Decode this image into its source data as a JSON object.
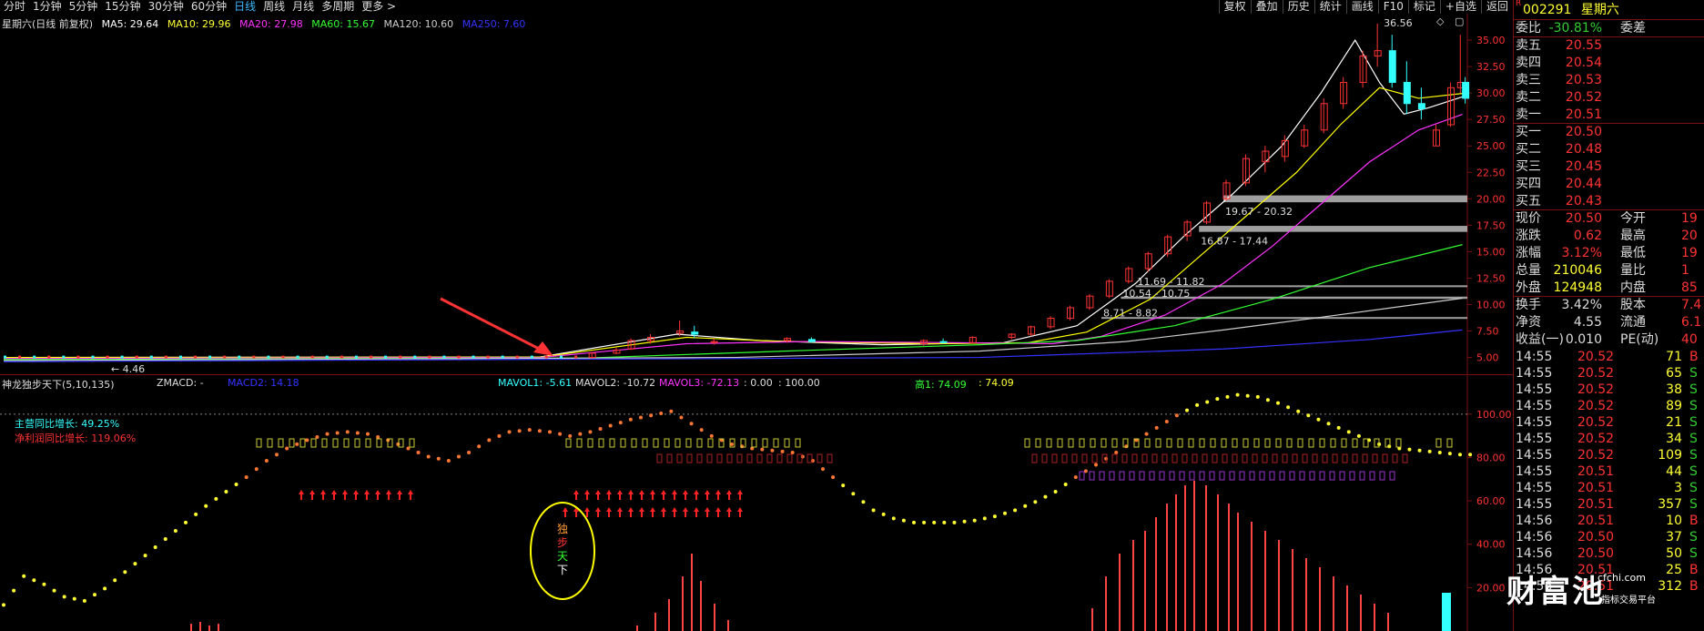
{
  "timeframes": [
    "分时",
    "1分钟",
    "5分钟",
    "15分钟",
    "30分钟",
    "60分钟",
    "日线",
    "周线",
    "月线",
    "多周期",
    "更多 >"
  ],
  "active_tab": "日线",
  "toolbar": [
    "复权",
    "叠加",
    "历史",
    "统计",
    "画线",
    "F10",
    "标记",
    "+自选",
    "返回"
  ],
  "main_legend": {
    "title": "星期六(日线 前复权)",
    "ma5": "MA5: 29.64",
    "ma10": "MA10: 29.96",
    "ma20": "MA20: 27.98",
    "ma60": "MA60: 15.67",
    "ma120": "MA120: 10.60",
    "ma250": "MA250: 7.60"
  },
  "colors": {
    "ma5": "#ffffff",
    "ma10": "#ffff00",
    "ma20": "#ff33ff",
    "ma60": "#33ff33",
    "ma120": "#cccccc",
    "ma250": "#3333ff",
    "up": "#ff3333",
    "down": "#33ffff",
    "accent": "#3db8ff"
  },
  "price_labels": {
    "high": "36.56",
    "low": "4.46",
    "box1": "19.67 - 20.32",
    "box2": "16.87 - 17.44",
    "box3": "11.69 - 11.82",
    "box4": "10.54 - 10.75",
    "box5": "8.71 - 8.82"
  },
  "sub_legend": {
    "title": "神龙独步天下(5,10,135)",
    "zmacd": "ZMACD: -",
    "macd2": "MACD2: 14.18",
    "mavol1": "MAVOL1: -5.61",
    "mavol2": "MAVOL2: -10.72",
    "mavol3": "MAVOL3: -72.13",
    "v1": ": 0.00",
    "v2": ": 100.00",
    "gao": "高1: 74.09",
    "v3": ": 74.09"
  },
  "indicator_labels": {
    "revenue": "主营同比增长: 49.25%",
    "profit": "净利润同比增长: 119.06%"
  },
  "circle_text": [
    "独",
    "步",
    "天",
    "下"
  ],
  "chart_data": [
    {
      "type": "line",
      "title": "星期六(日线 前复权)",
      "ylim": [
        3.5,
        37.5
      ],
      "yticks": [
        5.0,
        7.5,
        10.0,
        12.5,
        15.0,
        17.5,
        20.0,
        22.5,
        25.0,
        27.5,
        30.0,
        32.5,
        35.0
      ],
      "ytick_labels": [
        "5.00",
        "7.50",
        "10.00",
        "12.50",
        "15.00",
        "17.50",
        "20.00",
        "22.50",
        "25.00",
        "27.50",
        "30.00",
        "32.50",
        "35.00"
      ],
      "x_count": 300,
      "series": [
        {
          "name": "MA5",
          "key": "ma5",
          "points": [
            [
              0,
              5.0
            ],
            [
              110,
              5.05
            ],
            [
              138,
              7.2
            ],
            [
              155,
              6.6
            ],
            [
              180,
              6.2
            ],
            [
              205,
              6.4
            ],
            [
              220,
              8.0
            ],
            [
              232,
              12.0
            ],
            [
              242,
              16.5
            ],
            [
              252,
              20.5
            ],
            [
              262,
              25.0
            ],
            [
              270,
              30.0
            ],
            [
              277,
              35.0
            ],
            [
              282,
              31.0
            ],
            [
              287,
              28.0
            ],
            [
              292,
              28.6
            ],
            [
              299,
              29.64
            ]
          ]
        },
        {
          "name": "MA10",
          "key": "ma10",
          "points": [
            [
              0,
              5.0
            ],
            [
              110,
              5.03
            ],
            [
              140,
              6.9
            ],
            [
              160,
              6.5
            ],
            [
              190,
              6.3
            ],
            [
              210,
              6.4
            ],
            [
              222,
              7.4
            ],
            [
              235,
              10.5
            ],
            [
              245,
              14.5
            ],
            [
              255,
              18.5
            ],
            [
              265,
              22.5
            ],
            [
              274,
              27.0
            ],
            [
              282,
              30.5
            ],
            [
              290,
              29.5
            ],
            [
              299,
              29.96
            ]
          ]
        },
        {
          "name": "MA20",
          "key": "ma20",
          "points": [
            [
              0,
              4.9
            ],
            [
              110,
              5.0
            ],
            [
              140,
              6.3
            ],
            [
              165,
              6.5
            ],
            [
              195,
              6.4
            ],
            [
              215,
              6.3
            ],
            [
              225,
              7.0
            ],
            [
              238,
              9.0
            ],
            [
              250,
              12.0
            ],
            [
              260,
              15.5
            ],
            [
              270,
              19.5
            ],
            [
              280,
              23.5
            ],
            [
              290,
              26.5
            ],
            [
              299,
              27.98
            ]
          ]
        },
        {
          "name": "MA60",
          "key": "ma60",
          "points": [
            [
              0,
              4.8
            ],
            [
              120,
              4.95
            ],
            [
              160,
              5.6
            ],
            [
              200,
              6.2
            ],
            [
              220,
              6.6
            ],
            [
              240,
              8.0
            ],
            [
              260,
              10.5
            ],
            [
              280,
              13.5
            ],
            [
              299,
              15.67
            ]
          ]
        },
        {
          "name": "MA120",
          "key": "ma120",
          "points": [
            [
              0,
              4.7
            ],
            [
              150,
              5.0
            ],
            [
              200,
              5.6
            ],
            [
              230,
              6.5
            ],
            [
              250,
              7.6
            ],
            [
              270,
              8.8
            ],
            [
              299,
              10.6
            ]
          ]
        },
        {
          "name": "MA250",
          "key": "ma250",
          "points": [
            [
              0,
              4.6
            ],
            [
              200,
              5.0
            ],
            [
              250,
              5.8
            ],
            [
              280,
              6.7
            ],
            [
              299,
              7.6
            ]
          ]
        }
      ],
      "candles": [
        [
          120,
          5.0,
          5.5,
          4.9,
          5.4
        ],
        [
          125,
          5.4,
          5.9,
          5.3,
          5.7
        ],
        [
          128,
          5.8,
          6.8,
          5.7,
          6.6
        ],
        [
          132,
          6.6,
          7.2,
          6.3,
          6.9
        ],
        [
          138,
          7.3,
          8.5,
          7.0,
          7.5
        ],
        [
          141,
          7.4,
          8.0,
          6.8,
          7.2
        ],
        [
          145,
          6.4,
          6.8,
          6.2,
          6.5
        ],
        [
          160,
          6.6,
          6.9,
          6.4,
          6.8
        ],
        [
          165,
          6.7,
          6.9,
          6.4,
          6.5
        ],
        [
          188,
          6.3,
          6.7,
          6.1,
          6.6
        ],
        [
          192,
          6.5,
          6.8,
          6.3,
          6.4
        ],
        [
          198,
          6.4,
          7.0,
          6.3,
          6.9
        ],
        [
          206,
          6.9,
          7.3,
          6.7,
          7.2
        ],
        [
          210,
          7.2,
          8.0,
          7.0,
          7.9
        ],
        [
          214,
          7.9,
          8.9,
          7.7,
          8.7
        ],
        [
          218,
          8.7,
          9.9,
          8.5,
          9.7
        ],
        [
          222,
          9.7,
          11.0,
          9.5,
          10.8
        ],
        [
          226,
          10.8,
          12.4,
          10.6,
          12.2
        ],
        [
          230,
          12.2,
          13.6,
          12.0,
          13.4
        ],
        [
          234,
          13.4,
          15.0,
          13.1,
          14.8
        ],
        [
          238,
          14.8,
          16.6,
          14.5,
          16.4
        ],
        [
          242,
          16.5,
          18.0,
          16.0,
          17.8
        ],
        [
          246,
          17.8,
          19.8,
          17.6,
          19.6
        ],
        [
          250,
          20.0,
          21.8,
          19.8,
          21.5
        ],
        [
          254,
          21.5,
          24.2,
          21.2,
          23.8
        ],
        [
          258,
          23.5,
          25.0,
          22.5,
          24.5
        ],
        [
          262,
          24.0,
          26.0,
          23.5,
          25.5
        ],
        [
          266,
          25.0,
          27.0,
          24.8,
          26.5
        ],
        [
          270,
          26.5,
          29.5,
          26.2,
          29.0
        ],
        [
          274,
          29.0,
          31.5,
          28.5,
          31.0
        ],
        [
          278,
          31.0,
          34.0,
          30.5,
          33.5
        ],
        [
          281,
          33.5,
          36.56,
          32.5,
          34.0
        ],
        [
          284,
          34.0,
          35.5,
          30.5,
          31.0
        ],
        [
          287,
          31.0,
          33.0,
          28.0,
          29.0
        ],
        [
          290,
          29.0,
          30.5,
          27.5,
          28.5
        ],
        [
          293,
          25.0,
          27.0,
          25.0,
          26.5
        ],
        [
          296,
          27.0,
          31.0,
          26.8,
          30.5
        ],
        [
          298,
          30.5,
          35.5,
          30.0,
          31.0
        ],
        [
          299,
          31.0,
          31.5,
          29.0,
          29.5
        ]
      ],
      "range_boxes": [
        {
          "x0": 250,
          "x1": 300,
          "y0": 19.67,
          "y1": 20.32
        },
        {
          "x0": 245,
          "x1": 300,
          "y0": 16.87,
          "y1": 17.44
        },
        {
          "x0": 232,
          "x1": 300,
          "y0": 11.69,
          "y1": 11.82
        },
        {
          "x0": 229,
          "x1": 300,
          "y0": 10.54,
          "y1": 10.75
        },
        {
          "x0": 225,
          "x1": 300,
          "y0": 8.71,
          "y1": 8.82
        }
      ]
    },
    {
      "type": "line",
      "title": "神龙独步天下(5,10,135)",
      "ylim": [
        0,
        110
      ],
      "yticks": [
        20,
        40,
        60,
        80,
        100
      ],
      "ytick_labels": [
        "20.00",
        "40.00",
        "60.00",
        "80.00",
        "100.00"
      ],
      "dotted_line": [
        0,
        14,
        10,
        4,
        2,
        8,
        16,
        24,
        32,
        40,
        48,
        55,
        62,
        70,
        76,
        80,
        83,
        84,
        83,
        80,
        76,
        72,
        70,
        74,
        80,
        84,
        85,
        84,
        82,
        84,
        87,
        90,
        92,
        94,
        88,
        82,
        78,
        76,
        75,
        74,
        70,
        62,
        54,
        46,
        42,
        40,
        40,
        40,
        41,
        43,
        46,
        50,
        55,
        62,
        68,
        74,
        80,
        86,
        92,
        97,
        100,
        102,
        101,
        98,
        94,
        90,
        86,
        82,
        78,
        76,
        75,
        74,
        73
      ]
    }
  ]
}
